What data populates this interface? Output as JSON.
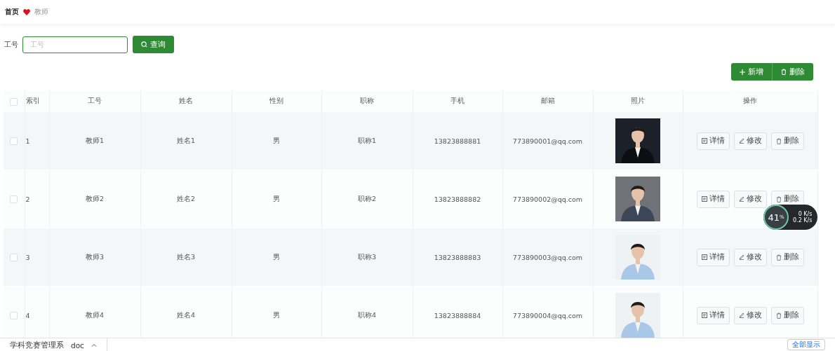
{
  "breadcrumb": {
    "home": "首页",
    "current": "教师"
  },
  "search": {
    "label": "工号",
    "placeholder": "工号",
    "button": "查询"
  },
  "toolbar": {
    "add": "新增",
    "delete": "删除"
  },
  "table": {
    "select_all": {
      "checked": false
    },
    "columns": [
      "索引",
      "工号",
      "姓名",
      "性别",
      "职称",
      "手机",
      "邮箱",
      "照片",
      "操作"
    ],
    "rows": [
      {
        "selected": false,
        "index": "1",
        "id": "教师1",
        "name": "姓名1",
        "gender": "男",
        "title": "职称1",
        "phone": "13823888881",
        "email": "773890001@qq.com",
        "photo": {
          "kind": "picture"
        },
        "actions": [
          "详情",
          "修改",
          "删除"
        ]
      },
      {
        "selected": false,
        "index": "2",
        "id": "教师2",
        "name": "姓名2",
        "gender": "男",
        "title": "职称2",
        "phone": "13823888882",
        "email": "773890002@qq.com",
        "photo": {
          "kind": "picture"
        },
        "actions": [
          "详情",
          "修改",
          "删除"
        ]
      },
      {
        "selected": false,
        "index": "3",
        "id": "教师3",
        "name": "姓名3",
        "gender": "男",
        "title": "职称3",
        "phone": "13823888883",
        "email": "773890003@qq.com",
        "photo": {
          "kind": "picture"
        },
        "actions": [
          "详情",
          "修改",
          "删除"
        ]
      },
      {
        "selected": false,
        "index": "4",
        "id": "教师4",
        "name": "姓名4",
        "gender": "男",
        "title": "职称4",
        "phone": "13823888884",
        "email": "773890004@qq.com",
        "photo": {
          "kind": "picture"
        },
        "actions": [
          "详情",
          "修改",
          "删除"
        ]
      }
    ]
  },
  "speed_widget": {
    "percent": "41",
    "unit": "%",
    "upload": "0",
    "upload_unit": "K/s",
    "download": "0.2",
    "download_unit": "K/s"
  },
  "download_bar": {
    "file": "学科竞赛管理系",
    "ext": "doc",
    "show_all": "全部显示"
  }
}
